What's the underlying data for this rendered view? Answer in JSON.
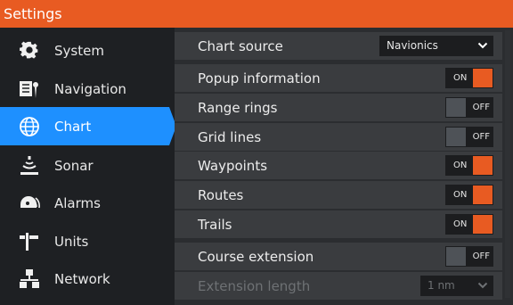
{
  "window": {
    "title": "Settings"
  },
  "colors": {
    "accent": "#e85b22",
    "active": "#1e90ff"
  },
  "sidebar": {
    "items": [
      {
        "label": "System",
        "icon": "gear-icon"
      },
      {
        "label": "Navigation",
        "icon": "navigation-icon"
      },
      {
        "label": "Chart",
        "icon": "globe-icon",
        "active": true
      },
      {
        "label": "Sonar",
        "icon": "sonar-icon"
      },
      {
        "label": "Alarms",
        "icon": "alarm-icon"
      },
      {
        "label": "Units",
        "icon": "units-icon"
      },
      {
        "label": "Network",
        "icon": "network-icon"
      }
    ]
  },
  "settings": {
    "chart_source": {
      "label": "Chart source",
      "value": "Navionics"
    },
    "popup_information": {
      "label": "Popup information",
      "state": "ON"
    },
    "range_rings": {
      "label": "Range rings",
      "state": "OFF"
    },
    "grid_lines": {
      "label": "Grid lines",
      "state": "OFF"
    },
    "waypoints": {
      "label": "Waypoints",
      "state": "ON"
    },
    "routes": {
      "label": "Routes",
      "state": "ON"
    },
    "trails": {
      "label": "Trails",
      "state": "ON"
    },
    "course_extension": {
      "label": "Course extension",
      "state": "OFF"
    },
    "extension_length": {
      "label": "Extension length",
      "value": "1 nm"
    }
  }
}
